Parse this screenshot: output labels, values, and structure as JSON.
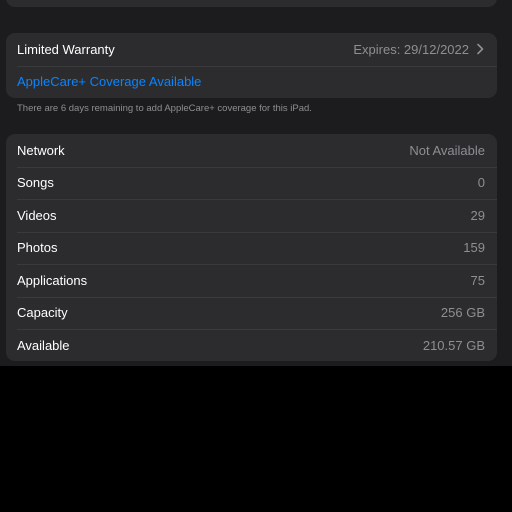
{
  "warranty": {
    "label": "Limited Warranty",
    "value": "Expires: 29/12/2022",
    "link": "AppleCare+ Coverage Available",
    "footnote": "There are 6 days remaining to add AppleCare+ coverage for this iPad."
  },
  "info": {
    "rows": [
      {
        "label": "Network",
        "value": "Not Available"
      },
      {
        "label": "Songs",
        "value": "0"
      },
      {
        "label": "Videos",
        "value": "29"
      },
      {
        "label": "Photos",
        "value": "159"
      },
      {
        "label": "Applications",
        "value": "75"
      },
      {
        "label": "Capacity",
        "value": "256 GB"
      },
      {
        "label": "Available",
        "value": "210.57 GB"
      }
    ]
  },
  "colors": {
    "background": "#1c1c1e",
    "card": "#2c2c2e",
    "link": "#0a84ff",
    "secondary_text": "#8e8e93"
  }
}
